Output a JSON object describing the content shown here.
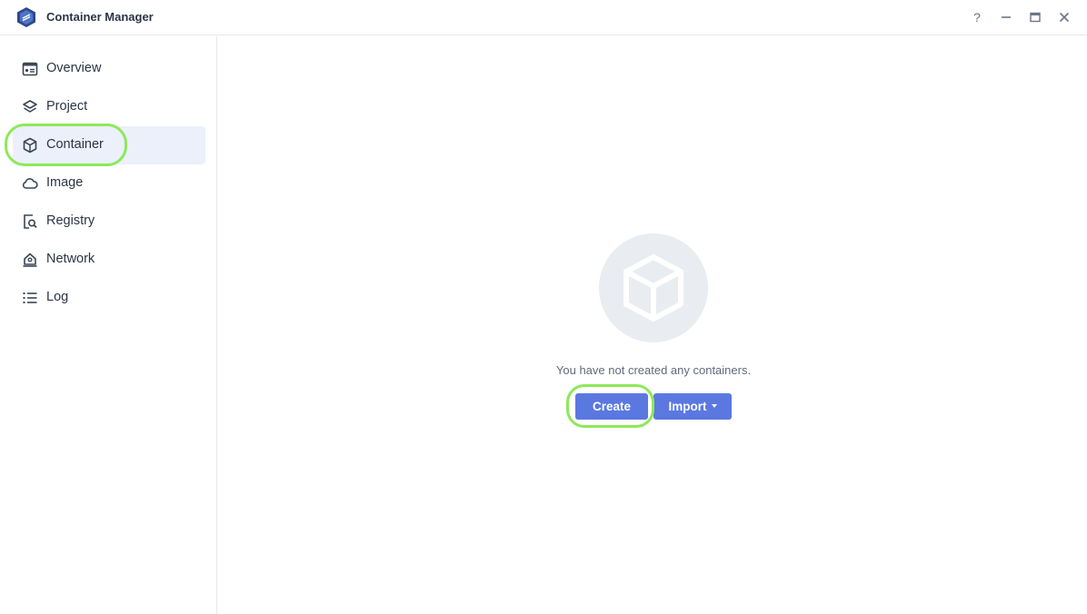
{
  "app": {
    "title": "Container Manager",
    "logo_icon": "container-manager-logo-icon",
    "accent_color": "#5b78e1",
    "highlight_color": "#8ee85a"
  },
  "window_controls": {
    "help": "?",
    "minimize": "—",
    "maximize": "▢",
    "close": "✕"
  },
  "sidebar": {
    "items": [
      {
        "label": "Overview",
        "icon": "overview-icon",
        "active": false
      },
      {
        "label": "Project",
        "icon": "layers-icon",
        "active": false
      },
      {
        "label": "Container",
        "icon": "cube-icon",
        "active": true
      },
      {
        "label": "Image",
        "icon": "cloud-icon",
        "active": false
      },
      {
        "label": "Registry",
        "icon": "registry-search-icon",
        "active": false
      },
      {
        "label": "Network",
        "icon": "network-home-icon",
        "active": false
      },
      {
        "label": "Log",
        "icon": "list-icon",
        "active": false
      }
    ]
  },
  "main": {
    "empty_icon": "cube-icon",
    "empty_message": "You have not created any containers.",
    "create_label": "Create",
    "import_label": "Import"
  }
}
